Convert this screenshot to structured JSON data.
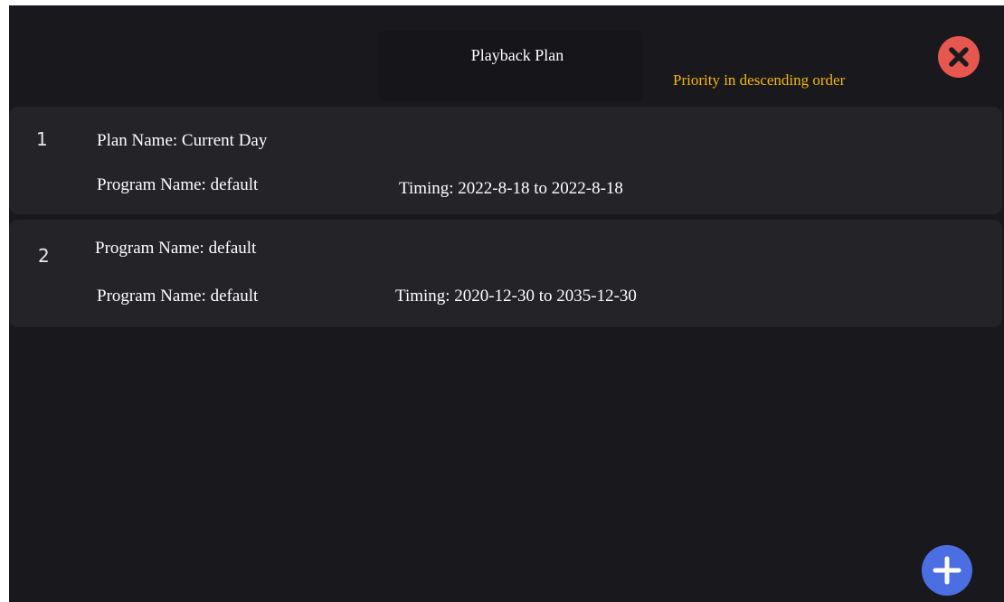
{
  "header": {
    "title": "Playback Plan",
    "priority_note": "Priority in descending order",
    "close_icon": "close-icon"
  },
  "plans": [
    {
      "index": "1",
      "line1": "Plan Name: Current Day",
      "line2": "Program Name: default",
      "timing": "Timing: 2022-8-18 to 2022-8-18"
    },
    {
      "index": "2",
      "line1": "Program Name: default",
      "line2": "Program Name: default",
      "timing": "Timing: 2020-12-30 to 2035-12-30"
    }
  ],
  "fab": {
    "icon": "plus-icon"
  },
  "colors": {
    "background": "#18181d",
    "card": "#232328",
    "accent_text": "#f5b800",
    "close": "#e5574f",
    "add": "#4b6fe2"
  }
}
